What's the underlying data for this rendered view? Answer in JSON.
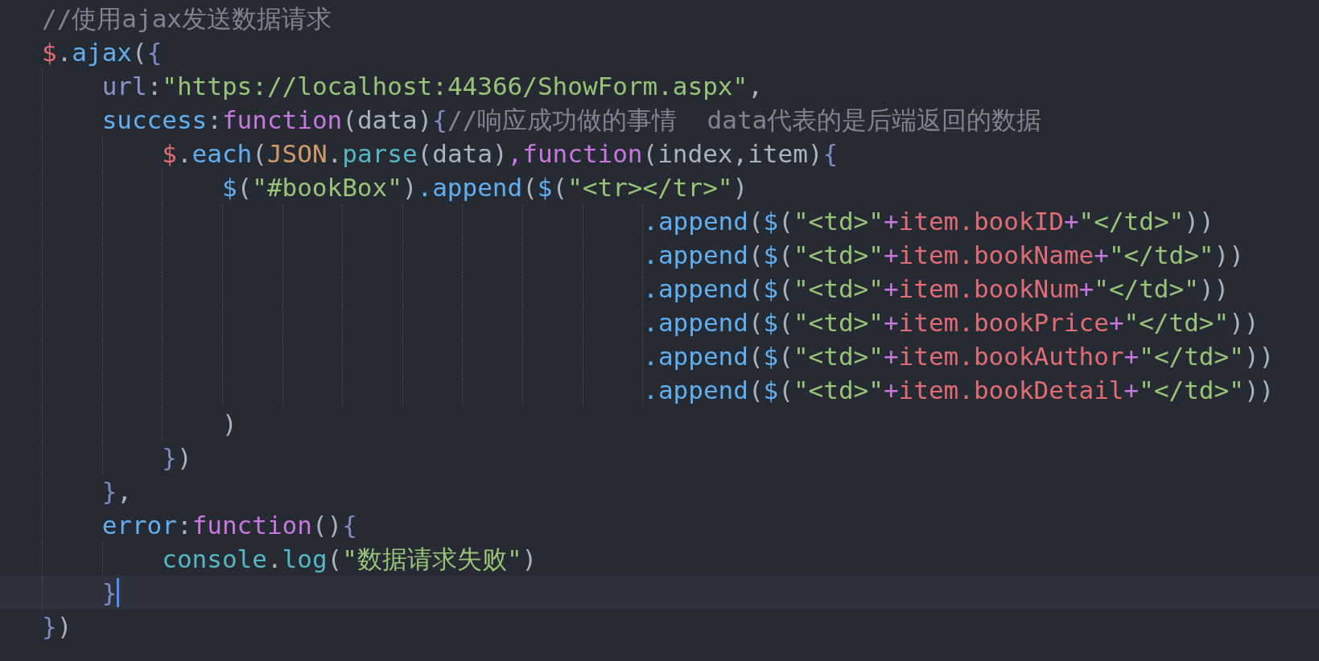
{
  "editor": {
    "lines": [
      {
        "current": false,
        "tokens": [
          {
            "kind": "comment",
            "text": "//使用ajax发送数据请求"
          }
        ]
      },
      {
        "current": false,
        "tokens": [
          {
            "kind": "variable",
            "text": "$"
          },
          {
            "kind": "punctuation",
            "text": "."
          },
          {
            "kind": "function",
            "text": "ajax"
          },
          {
            "kind": "punctuation",
            "text": "("
          },
          {
            "kind": "bracket",
            "text": "{"
          }
        ],
        "children": [
          {
            "current": false,
            "tokens": [
              {
                "kind": "property",
                "text": "url"
              },
              {
                "kind": "punctuation",
                "text": ":"
              },
              {
                "kind": "string",
                "text": "\"https://localhost:44366/ShowForm.aspx\""
              },
              {
                "kind": "punctuation",
                "text": ","
              }
            ]
          },
          {
            "current": false,
            "tokens": [
              {
                "kind": "function",
                "text": "success"
              },
              {
                "kind": "punctuation",
                "text": ":"
              },
              {
                "kind": "keyword",
                "text": "function"
              },
              {
                "kind": "punctuation",
                "text": "(data)"
              },
              {
                "kind": "bracket",
                "text": "{"
              },
              {
                "kind": "comment",
                "text": "//响应成功做的事情  data代表的是后端返回的数据"
              }
            ],
            "children": [
              {
                "current": false,
                "tokens": [
                  {
                    "kind": "variable",
                    "text": "$"
                  },
                  {
                    "kind": "punctuation",
                    "text": "."
                  },
                  {
                    "kind": "function",
                    "text": "each"
                  },
                  {
                    "kind": "punctuation",
                    "text": "("
                  },
                  {
                    "kind": "class",
                    "text": "JSON"
                  },
                  {
                    "kind": "punctuation",
                    "text": "."
                  },
                  {
                    "kind": "builtin",
                    "text": "parse"
                  },
                  {
                    "kind": "punctuation",
                    "text": "(data)"
                  },
                  {
                    "kind": "keyword",
                    "text": ",function"
                  },
                  {
                    "kind": "punctuation",
                    "text": "(index,item)"
                  },
                  {
                    "kind": "bracket",
                    "text": "{"
                  }
                ],
                "children": [
                  {
                    "current": false,
                    "tokens": [
                      {
                        "kind": "function",
                        "text": "$"
                      },
                      {
                        "kind": "punctuation",
                        "text": "("
                      },
                      {
                        "kind": "string",
                        "text": "\"#bookBox\""
                      },
                      {
                        "kind": "punctuation",
                        "text": ")"
                      },
                      {
                        "kind": "function",
                        "text": ".append"
                      },
                      {
                        "kind": "punctuation",
                        "text": "("
                      },
                      {
                        "kind": "function",
                        "text": "$"
                      },
                      {
                        "kind": "punctuation",
                        "text": "("
                      },
                      {
                        "kind": "string",
                        "text": "\"<tr></tr>\""
                      },
                      {
                        "kind": "punctuation",
                        "text": ")"
                      }
                    ],
                    "continuation": [
                      {
                        "current": false,
                        "tokens": [
                          {
                            "kind": "function",
                            "text": ".append"
                          },
                          {
                            "kind": "punctuation",
                            "text": "("
                          },
                          {
                            "kind": "function",
                            "text": "$"
                          },
                          {
                            "kind": "punctuation",
                            "text": "("
                          },
                          {
                            "kind": "string",
                            "text": "\"<td>\""
                          },
                          {
                            "kind": "operator",
                            "text": "+"
                          },
                          {
                            "kind": "variable",
                            "text": "item.bookID"
                          },
                          {
                            "kind": "operator",
                            "text": "+"
                          },
                          {
                            "kind": "string",
                            "text": "\"</td>\""
                          },
                          {
                            "kind": "punctuation",
                            "text": "))"
                          }
                        ]
                      },
                      {
                        "current": false,
                        "tokens": [
                          {
                            "kind": "function",
                            "text": ".append"
                          },
                          {
                            "kind": "punctuation",
                            "text": "("
                          },
                          {
                            "kind": "function",
                            "text": "$"
                          },
                          {
                            "kind": "punctuation",
                            "text": "("
                          },
                          {
                            "kind": "string",
                            "text": "\"<td>\""
                          },
                          {
                            "kind": "operator",
                            "text": "+"
                          },
                          {
                            "kind": "variable",
                            "text": "item.bookName"
                          },
                          {
                            "kind": "operator",
                            "text": "+"
                          },
                          {
                            "kind": "string",
                            "text": "\"</td>\""
                          },
                          {
                            "kind": "punctuation",
                            "text": "))"
                          }
                        ]
                      },
                      {
                        "current": false,
                        "tokens": [
                          {
                            "kind": "function",
                            "text": ".append"
                          },
                          {
                            "kind": "punctuation",
                            "text": "("
                          },
                          {
                            "kind": "function",
                            "text": "$"
                          },
                          {
                            "kind": "punctuation",
                            "text": "("
                          },
                          {
                            "kind": "string",
                            "text": "\"<td>\""
                          },
                          {
                            "kind": "operator",
                            "text": "+"
                          },
                          {
                            "kind": "variable",
                            "text": "item.bookNum"
                          },
                          {
                            "kind": "operator",
                            "text": "+"
                          },
                          {
                            "kind": "string",
                            "text": "\"</td>\""
                          },
                          {
                            "kind": "punctuation",
                            "text": "))"
                          }
                        ]
                      },
                      {
                        "current": false,
                        "tokens": [
                          {
                            "kind": "function",
                            "text": ".append"
                          },
                          {
                            "kind": "punctuation",
                            "text": "("
                          },
                          {
                            "kind": "function",
                            "text": "$"
                          },
                          {
                            "kind": "punctuation",
                            "text": "("
                          },
                          {
                            "kind": "string",
                            "text": "\"<td>\""
                          },
                          {
                            "kind": "operator",
                            "text": "+"
                          },
                          {
                            "kind": "variable",
                            "text": "item.bookPrice"
                          },
                          {
                            "kind": "operator",
                            "text": "+"
                          },
                          {
                            "kind": "string",
                            "text": "\"</td>\""
                          },
                          {
                            "kind": "punctuation",
                            "text": "))"
                          }
                        ]
                      },
                      {
                        "current": false,
                        "tokens": [
                          {
                            "kind": "function",
                            "text": ".append"
                          },
                          {
                            "kind": "punctuation",
                            "text": "("
                          },
                          {
                            "kind": "function",
                            "text": "$"
                          },
                          {
                            "kind": "punctuation",
                            "text": "("
                          },
                          {
                            "kind": "string",
                            "text": "\"<td>\""
                          },
                          {
                            "kind": "operator",
                            "text": "+"
                          },
                          {
                            "kind": "variable",
                            "text": "item.bookAuthor"
                          },
                          {
                            "kind": "operator",
                            "text": "+"
                          },
                          {
                            "kind": "string",
                            "text": "\"</td>\""
                          },
                          {
                            "kind": "punctuation",
                            "text": "))"
                          }
                        ]
                      },
                      {
                        "current": false,
                        "tokens": [
                          {
                            "kind": "function",
                            "text": ".append"
                          },
                          {
                            "kind": "punctuation",
                            "text": "("
                          },
                          {
                            "kind": "function",
                            "text": "$"
                          },
                          {
                            "kind": "punctuation",
                            "text": "("
                          },
                          {
                            "kind": "string",
                            "text": "\"<td>\""
                          },
                          {
                            "kind": "operator",
                            "text": "+"
                          },
                          {
                            "kind": "variable",
                            "text": "item.bookDetail"
                          },
                          {
                            "kind": "operator",
                            "text": "+"
                          },
                          {
                            "kind": "string",
                            "text": "\"</td>\""
                          },
                          {
                            "kind": "punctuation",
                            "text": "))"
                          }
                        ]
                      }
                    ]
                  },
                  {
                    "current": false,
                    "tokens": [
                      {
                        "kind": "punctuation",
                        "text": ")"
                      }
                    ]
                  }
                ]
              },
              {
                "current": false,
                "tokens": [
                  {
                    "kind": "bracket",
                    "text": "}"
                  },
                  {
                    "kind": "punctuation",
                    "text": ")"
                  }
                ]
              }
            ]
          },
          {
            "current": false,
            "tokens": [
              {
                "kind": "bracket",
                "text": "}"
              },
              {
                "kind": "punctuation",
                "text": ","
              }
            ]
          },
          {
            "current": false,
            "tokens": [
              {
                "kind": "function",
                "text": "error"
              },
              {
                "kind": "punctuation",
                "text": ":"
              },
              {
                "kind": "keyword",
                "text": "function"
              },
              {
                "kind": "punctuation",
                "text": "()"
              },
              {
                "kind": "bracket",
                "text": "{"
              }
            ],
            "children": [
              {
                "current": false,
                "tokens": [
                  {
                    "kind": "builtin",
                    "text": "console"
                  },
                  {
                    "kind": "punctuation",
                    "text": "."
                  },
                  {
                    "kind": "builtin",
                    "text": "log"
                  },
                  {
                    "kind": "punctuation",
                    "text": "("
                  },
                  {
                    "kind": "string",
                    "text": "\"数据请求失败\""
                  },
                  {
                    "kind": "punctuation",
                    "text": ")"
                  }
                ]
              }
            ]
          },
          {
            "current": true,
            "tokens": [
              {
                "kind": "bracket",
                "text": "}"
              }
            ]
          }
        ]
      },
      {
        "current": false,
        "tokens": [
          {
            "kind": "bracket",
            "text": "}"
          },
          {
            "kind": "punctuation",
            "text": ")"
          }
        ]
      }
    ]
  }
}
